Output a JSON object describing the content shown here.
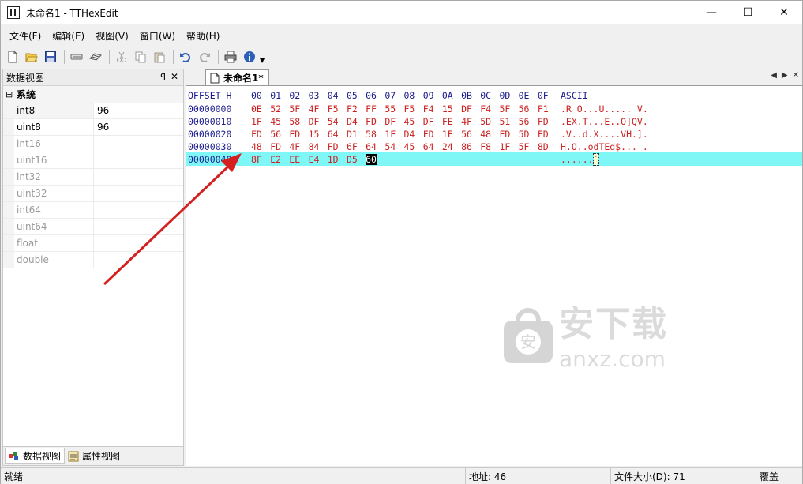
{
  "window": {
    "title": "未命名1 - TTHexEdit",
    "controls": {
      "minimize": "—",
      "maximize": "☐",
      "close": "✕"
    }
  },
  "menu": {
    "items": [
      "文件(F)",
      "编辑(E)",
      "视图(V)",
      "窗口(W)",
      "帮助(H)"
    ]
  },
  "toolbar": {
    "buttons": [
      "new-file-icon",
      "open-folder-icon",
      "save-icon",
      "fill-icon",
      "pattern-icon",
      "cut-icon",
      "copy-icon",
      "paste-icon",
      "undo-icon",
      "redo-icon",
      "print-icon",
      "info-icon"
    ]
  },
  "left_panel": {
    "title": "数据视图",
    "pin": "ꟼ",
    "close": "✕",
    "category": {
      "toggle": "⊟",
      "label": "系统"
    },
    "rows": [
      {
        "name": "int8",
        "value": "96"
      },
      {
        "name": "uint8",
        "value": "96"
      },
      {
        "name": "int16",
        "value": ""
      },
      {
        "name": "uint16",
        "value": ""
      },
      {
        "name": "int32",
        "value": ""
      },
      {
        "name": "uint32",
        "value": ""
      },
      {
        "name": "int64",
        "value": ""
      },
      {
        "name": "uint64",
        "value": ""
      },
      {
        "name": "float",
        "value": ""
      },
      {
        "name": "double",
        "value": ""
      }
    ],
    "tabs": [
      {
        "label": "数据视图",
        "active": true
      },
      {
        "label": "属性视图",
        "active": false
      }
    ]
  },
  "document": {
    "tab_label": "未命名1*",
    "nav": {
      "prev": "◀",
      "next": "▶",
      "close": "✕"
    },
    "header": {
      "offset": "OFFSET H",
      "bytes": [
        "00",
        "01",
        "02",
        "03",
        "04",
        "05",
        "06",
        "07",
        "08",
        "09",
        "0A",
        "0B",
        "0C",
        "0D",
        "0E",
        "0F"
      ],
      "ascii": "ASCII"
    },
    "rows": [
      {
        "offset": "00000000",
        "bytes": [
          "0E",
          "52",
          "5F",
          "4F",
          "F5",
          "F2",
          "FF",
          "55",
          "F5",
          "F4",
          "15",
          "DF",
          "F4",
          "5F",
          "56",
          "F1"
        ],
        "ascii": ".R_O...U....._V."
      },
      {
        "offset": "00000010",
        "bytes": [
          "1F",
          "45",
          "58",
          "DF",
          "54",
          "D4",
          "FD",
          "DF",
          "45",
          "DF",
          "FE",
          "4F",
          "5D",
          "51",
          "56",
          "FD"
        ],
        "ascii": ".EX.T...E..O]QV."
      },
      {
        "offset": "00000020",
        "bytes": [
          "FD",
          "56",
          "FD",
          "15",
          "64",
          "D1",
          "58",
          "1F",
          "D4",
          "FD",
          "1F",
          "56",
          "48",
          "FD",
          "5D",
          "FD"
        ],
        "ascii": ".V..d.X....VH.]."
      },
      {
        "offset": "00000030",
        "bytes": [
          "48",
          "FD",
          "4F",
          "84",
          "FD",
          "6F",
          "64",
          "54",
          "45",
          "64",
          "24",
          "86",
          "F8",
          "1F",
          "5F",
          "8D"
        ],
        "ascii": "H.O..odTEd$..._."
      },
      {
        "offset": "00000040",
        "bytes": [
          "8F",
          "E2",
          "EE",
          "E4",
          "1D",
          "D5",
          "60"
        ],
        "ascii": "......`",
        "active": true,
        "cursor_index": 6
      }
    ]
  },
  "watermark": {
    "cn": "安下载",
    "en": "anxz.com"
  },
  "status": {
    "ready": "就绪",
    "address": "地址: 46",
    "filesize": "文件大小(D): 71",
    "mode": "覆盖"
  },
  "colors": {
    "offset_blue": "#1b1b8f",
    "byte_red": "#cc2222",
    "active_row": "#7ff7f7",
    "annotation_arrow": "#d42020"
  }
}
